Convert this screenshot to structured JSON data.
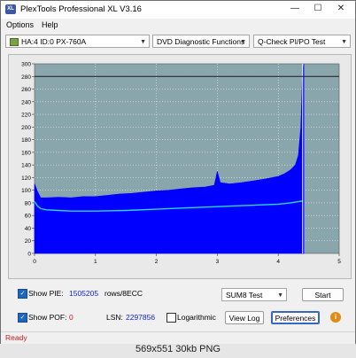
{
  "window": {
    "title": "PlexTools Professional XL V3.16"
  },
  "menu": {
    "options": "Options",
    "help": "Help"
  },
  "toolbar": {
    "drive": "HA:4 ID:0  PX-760A",
    "function": "DVD Diagnostic Functions",
    "test": "Q-Check PI/PO Test"
  },
  "chart_data": {
    "type": "area",
    "x_ticks": [
      "0",
      "1",
      "2",
      "3",
      "4",
      "5"
    ],
    "y_ticks": [
      "0",
      "20",
      "40",
      "60",
      "80",
      "100",
      "120",
      "140",
      "160",
      "180",
      "200",
      "220",
      "240",
      "260",
      "280",
      "300"
    ],
    "xlim": [
      0,
      5
    ],
    "ylim": [
      0,
      300
    ],
    "grid": true,
    "background": "#8aa6ad",
    "series": [
      {
        "color": "#0000ff",
        "x": [
          0,
          0.05,
          0.1,
          0.2,
          0.4,
          0.6,
          0.8,
          1.0,
          1.2,
          1.4,
          1.6,
          1.8,
          2.0,
          2.2,
          2.4,
          2.6,
          2.8,
          2.95,
          3.0,
          3.05,
          3.2,
          3.4,
          3.6,
          3.8,
          4.0,
          4.1,
          4.2,
          4.28,
          4.33,
          4.37,
          4.4,
          4.42
        ],
        "y": [
          110,
          98,
          88,
          88,
          89,
          88,
          90,
          90,
          92,
          94,
          95,
          97,
          99,
          100,
          102,
          104,
          105,
          108,
          130,
          112,
          110,
          112,
          115,
          118,
          122,
          126,
          132,
          140,
          155,
          200,
          290,
          300
        ]
      },
      {
        "color": "#2ad8e8",
        "x": [
          0,
          0.05,
          0.1,
          0.2,
          0.4,
          0.6,
          0.8,
          1.0,
          1.5,
          2.0,
          2.5,
          3.0,
          3.5,
          4.0,
          4.2,
          4.4
        ],
        "y": [
          82,
          75,
          71,
          69,
          68,
          67,
          67,
          67,
          68,
          70,
          72,
          74,
          76,
          78,
          80,
          83
        ]
      }
    ],
    "vline": {
      "x": 4.4,
      "color": "#ffffff"
    },
    "hline": {
      "y": 280,
      "color": "#1a1a1a"
    }
  },
  "controls": {
    "show_pie_label": "Show PIE:",
    "pie_value": "1505205",
    "pie_unit": "rows/8ECC",
    "show_pof_label": "Show POF:",
    "pof_value": "0",
    "lsn_label": "LSN:",
    "lsn_value": "2297856",
    "sum_select": "SUM8 Test",
    "start_label": "Start",
    "logarithmic_label": "Logarithmic",
    "viewlog_label": "View Log",
    "preferences_label": "Preferences",
    "info_glyph": "i"
  },
  "status": "Ready",
  "caption": "569x551  30kb  PNG"
}
